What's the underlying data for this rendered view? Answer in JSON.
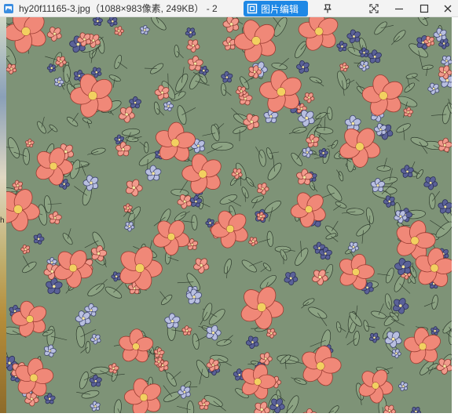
{
  "window": {
    "title": "hy20f11165-3.jpg（1088×983像素, 249KB） - 2",
    "edit_button_label": "图片编辑"
  },
  "desktop": {
    "sidebar_glyph": "h"
  },
  "image": {
    "description_name": "floral-pattern-image",
    "colors": {
      "background": "#7e9377",
      "coral": "#f08878",
      "coral_dark": "#e46a5c",
      "navy": "#5a6198",
      "lilac": "#b8bfe0",
      "leaf_line": "#2d3a2c",
      "center": "#f2d060"
    }
  },
  "icons": {
    "app": "image-file-icon",
    "edit": "image-edit-icon",
    "pin": "pin-icon",
    "fullscreen": "fullscreen-icon",
    "minimize": "minimize-icon",
    "maximize": "maximize-icon",
    "close": "close-icon"
  }
}
